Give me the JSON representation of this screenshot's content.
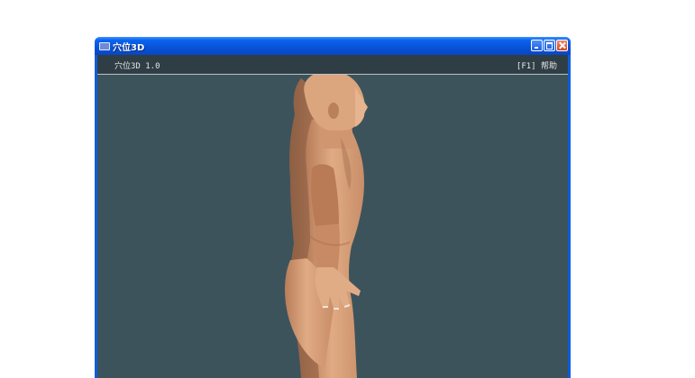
{
  "window": {
    "title": "穴位3D",
    "controls": {
      "minimize": "minimize-icon",
      "maximize": "maximize-icon",
      "close": "close-icon"
    }
  },
  "infobar": {
    "app_version": "穴位3D 1.0",
    "help_hint": "[F1] 帮助"
  },
  "viewport": {
    "background_color": "#3d535c",
    "model": "human-body-3d-side-view",
    "skin_color": "#d9a27a"
  }
}
